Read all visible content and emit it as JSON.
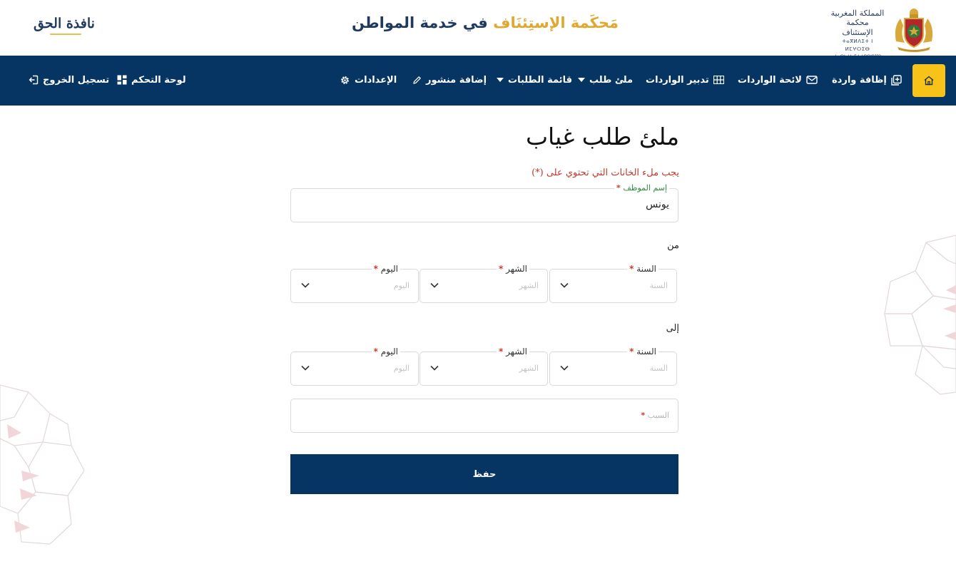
{
  "header": {
    "kingdom_line1": "المملكة المغربية",
    "kingdom_line2": "محكمة الإستئناف",
    "kingdom_line3": "ⵜⴰⴳⵍⴷⵉⵜ ⵏ ⵍⵎⵖⵔⵉⴱ",
    "kingdom_line4": "ⵜⴰⵙⵏⴰⵡⴰⵢⵜ ⵏ ⵓⵙⵏⵓⴼⵓ",
    "title_gold": "مَحكَمة الإستِئنَاف",
    "title_navy": "في خدمة المواطن",
    "brand": "نافذة الحق"
  },
  "nav": {
    "items": [
      {
        "label": "إظافة واردة",
        "icon": "plus-square-icon"
      },
      {
        "label": "لائحة الواردات",
        "icon": "envelope-icon"
      },
      {
        "label": "تدبير الواردات",
        "icon": "grid-icon"
      },
      {
        "label": "ملئ طلب",
        "icon": "caret-down-icon"
      },
      {
        "label": "قائمة الطلبات",
        "icon": "caret-down-icon"
      },
      {
        "label": "إضافة منشور",
        "icon": "pencil-icon"
      },
      {
        "label": "الإعدادات",
        "icon": "gear-icon"
      },
      {
        "label": "لوحة التحكم",
        "icon": "dashboard-icon"
      },
      {
        "label": "تسجيل الخروج",
        "icon": "logout-icon"
      }
    ]
  },
  "form": {
    "title": "ملئ طلب غياب",
    "required_note": "يجب ملء الخانات التي تحتوي على (*)",
    "employee": {
      "label": "إسم الموظف",
      "value": "يونس"
    },
    "from_label": "من",
    "to_label": "إلى",
    "year": {
      "label": "السنة",
      "placeholder": "السنة"
    },
    "month": {
      "label": "الشهر",
      "placeholder": "الشهر"
    },
    "day": {
      "label": "اليوم",
      "placeholder": "اليوم"
    },
    "reason": {
      "placeholder": "السبب"
    },
    "required_mark": "*",
    "save_label": "حفظ"
  },
  "colors": {
    "navy": "#063563",
    "gold": "#f7c319",
    "title_gold": "#e0a82e",
    "required_red": "#c0392b"
  }
}
